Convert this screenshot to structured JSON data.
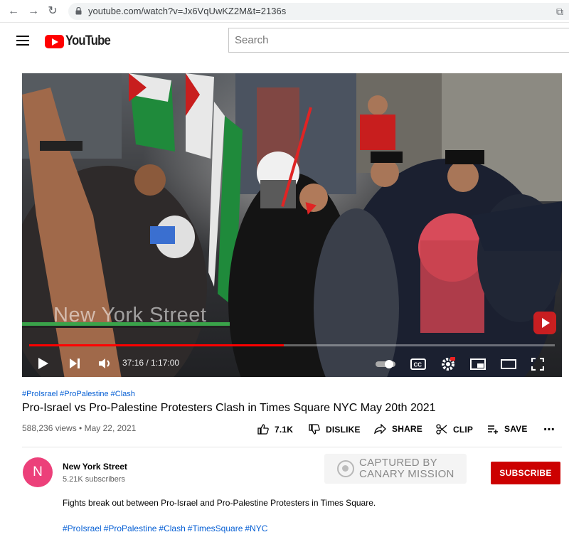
{
  "browser": {
    "url": "youtube.com/watch?v=Jx6VqUwKZ2M&t=2136s"
  },
  "header": {
    "logo_text": "YouTube",
    "search_placeholder": "Search"
  },
  "video": {
    "watermark": "New York Street",
    "time_current": "37:16",
    "time_total": "1:17:00",
    "progress": 0.484,
    "colors": {
      "progress": "#ff0000",
      "watermark_bar": "#3aa34a"
    }
  },
  "info": {
    "tags": [
      "#ProIsrael",
      "#ProPalestine",
      "#Clash"
    ],
    "title": "Pro-Israel vs Pro-Palestine Protesters Clash in Times Square NYC May 20th 2021",
    "views": "588,236 views",
    "date": "May 22, 2021",
    "actions": {
      "like": "7.1K",
      "dislike": "DISLIKE",
      "share": "SHARE",
      "clip": "CLIP",
      "save": "SAVE"
    }
  },
  "channel": {
    "avatar_letter": "N",
    "avatar_color": "#ec407a",
    "name": "New York Street",
    "subscribers": "5.21K subscribers",
    "subscribe_label": "SUBSCRIBE",
    "watermark_line1": "CAPTURED BY",
    "watermark_line2": "CANARY MISSION"
  },
  "description": {
    "text": "Fights break out between Pro-Israel and Pro-Palestine Protesters in Times Square.",
    "tags": [
      "#ProIsrael",
      "#ProPalestine",
      "#Clash",
      "#TimesSquare",
      "#NYC"
    ]
  }
}
